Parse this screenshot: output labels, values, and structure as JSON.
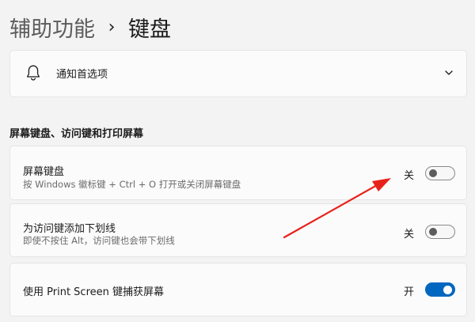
{
  "header": {
    "parent": "辅助功能",
    "separator": "›",
    "current": "键盘"
  },
  "notifications": {
    "label": "通知首选项",
    "icon": "bell-icon",
    "expand_icon": "chevron-down-icon"
  },
  "section": {
    "title": "屏幕键盘、访问键和打印屏幕"
  },
  "settings": {
    "on_screen_keyboard": {
      "title": "屏幕键盘",
      "description": "按 Windows 徽标键 + Ctrl + O 打开或关闭屏幕键盘",
      "state_label": "关",
      "enabled": false
    },
    "access_keys": {
      "title": "为访问键添加下划线",
      "description": "即使不按住 Alt，访问键也会带下划线",
      "state_label": "关",
      "enabled": false
    },
    "print_screen": {
      "title": "使用 Print Screen 键捕获屏幕",
      "state_label": "开",
      "enabled": true
    }
  },
  "colors": {
    "accent": "#0067c0",
    "annotation_arrow": "#e8221b",
    "background": "#f3f3f3",
    "card": "#fbfbfb"
  }
}
